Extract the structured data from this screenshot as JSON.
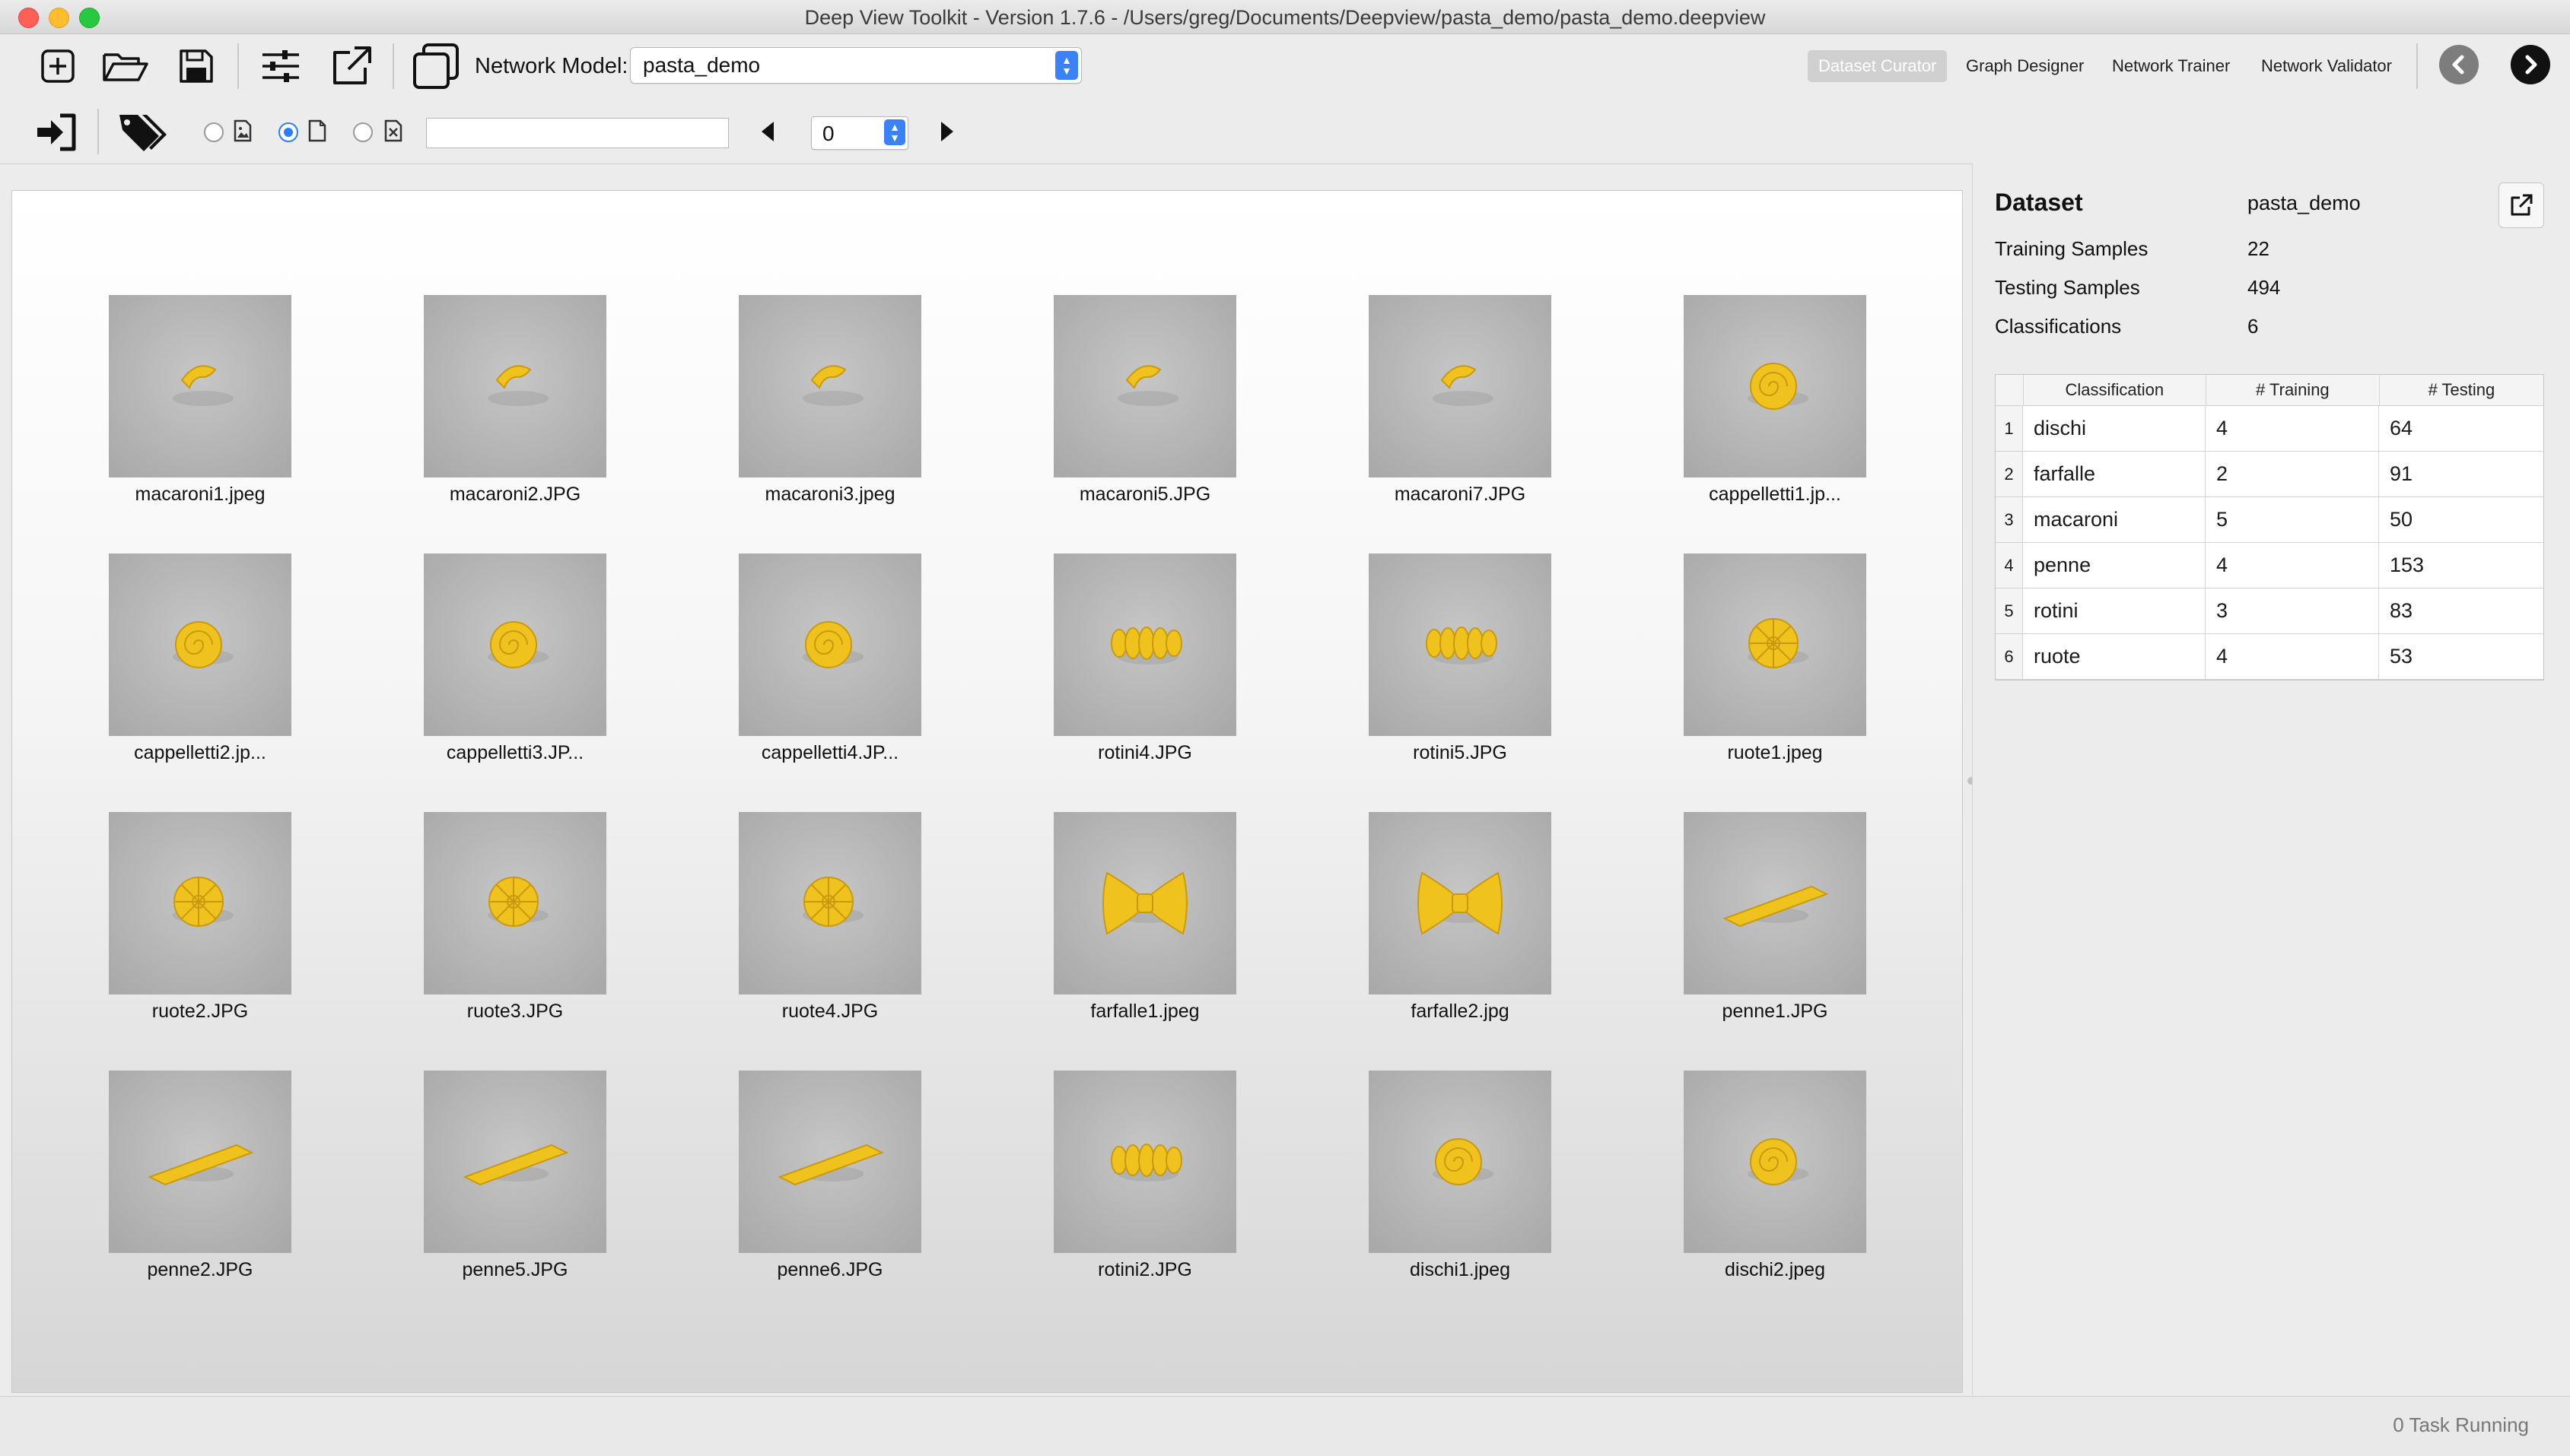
{
  "window": {
    "title": "Deep View Toolkit  -  Version 1.7.6 - /Users/greg/Documents/Deepview/pasta_demo/pasta_demo.deepview"
  },
  "toolbar": {
    "network_model_label": "Network Model:",
    "network_model_value": "pasta_demo",
    "modes": [
      {
        "label": "Dataset Curator",
        "active": true
      },
      {
        "label": "Graph Designer",
        "active": false
      },
      {
        "label": "Network Trainer",
        "active": false
      },
      {
        "label": "Network Validator",
        "active": false
      }
    ],
    "filter_text": "",
    "page_value": "0"
  },
  "gallery": {
    "items": [
      {
        "name": "macaroni1.jpeg",
        "shape": "macaroni"
      },
      {
        "name": "macaroni2.JPG",
        "shape": "macaroni"
      },
      {
        "name": "macaroni3.jpeg",
        "shape": "macaroni"
      },
      {
        "name": "macaroni5.JPG",
        "shape": "macaroni"
      },
      {
        "name": "macaroni7.JPG",
        "shape": "macaroni"
      },
      {
        "name": "cappelletti1.jp...",
        "shape": "spiral"
      },
      {
        "name": "cappelletti2.jp...",
        "shape": "spiral"
      },
      {
        "name": "cappelletti3.JP...",
        "shape": "spiral"
      },
      {
        "name": "cappelletti4.JP...",
        "shape": "spiral"
      },
      {
        "name": "rotini4.JPG",
        "shape": "rotini"
      },
      {
        "name": "rotini5.JPG",
        "shape": "rotini"
      },
      {
        "name": "ruote1.jpeg",
        "shape": "wheel"
      },
      {
        "name": "ruote2.JPG",
        "shape": "wheel"
      },
      {
        "name": "ruote3.JPG",
        "shape": "wheel"
      },
      {
        "name": "ruote4.JPG",
        "shape": "wheel"
      },
      {
        "name": "farfalle1.jpeg",
        "shape": "bowtie"
      },
      {
        "name": "farfalle2.jpg",
        "shape": "bowtie"
      },
      {
        "name": "penne1.JPG",
        "shape": "penne"
      },
      {
        "name": "penne2.JPG",
        "shape": "penne"
      },
      {
        "name": "penne5.JPG",
        "shape": "penne"
      },
      {
        "name": "penne6.JPG",
        "shape": "penne"
      },
      {
        "name": "rotini2.JPG",
        "shape": "rotini"
      },
      {
        "name": "dischi1.jpeg",
        "shape": "spiral"
      },
      {
        "name": "dischi2.jpeg",
        "shape": "spiral"
      }
    ]
  },
  "dataset": {
    "heading": "Dataset",
    "name": "pasta_demo",
    "training_label": "Training Samples",
    "training_value": "22",
    "testing_label": "Testing Samples",
    "testing_value": "494",
    "classes_label": "Classifications",
    "classes_value": "6",
    "table": {
      "headers": [
        "Classification",
        "# Training",
        "# Testing"
      ],
      "rows": [
        {
          "idx": "1",
          "name": "dischi",
          "train": "4",
          "test": "64"
        },
        {
          "idx": "2",
          "name": "farfalle",
          "train": "2",
          "test": "91"
        },
        {
          "idx": "3",
          "name": "macaroni",
          "train": "5",
          "test": "50"
        },
        {
          "idx": "4",
          "name": "penne",
          "train": "4",
          "test": "153"
        },
        {
          "idx": "5",
          "name": "rotini",
          "train": "3",
          "test": "83"
        },
        {
          "idx": "6",
          "name": "ruote",
          "train": "4",
          "test": "53"
        }
      ]
    }
  },
  "status": {
    "text": "0 Task Running"
  },
  "colors": {
    "pasta": "#f0c21e",
    "accent": "#3b82f6"
  }
}
